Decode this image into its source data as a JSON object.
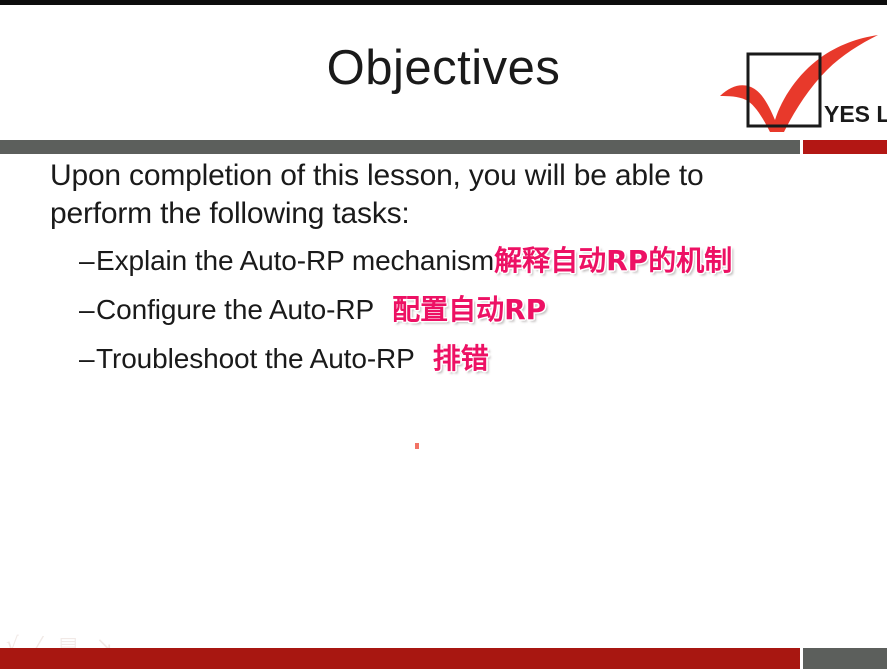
{
  "slide": {
    "title": "Objectives",
    "lead_lines": [
      "Upon completion of this lesson, you will be able to",
      "perform the following tasks:"
    ],
    "bullet_marker": "–",
    "bullets": [
      {
        "en": "Explain the Auto-RP mechanism",
        "cn": "解释自动RP的机制"
      },
      {
        "en": "Configure the Auto-RP",
        "cn": "配置自动RP"
      },
      {
        "en": "Troubleshoot the Auto-RP",
        "cn": "排错"
      }
    ],
    "watermark": "√ ⁄ ▤ ↘"
  },
  "logo": {
    "text": "YES LAB",
    "check_color": "#E8392B",
    "box_color": "#1a1a1a"
  },
  "colors": {
    "bar_gray": "#5c5f5c",
    "bar_red_top": "#b31714",
    "bar_red_bottom": "#a81711",
    "annotation_pink": "#ED1164",
    "text_black": "#1a1a1a"
  }
}
